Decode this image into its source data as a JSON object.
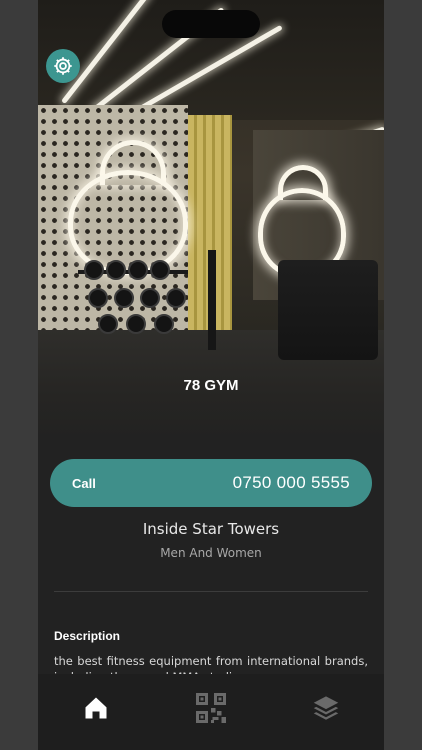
{
  "hero": {
    "title": "78 GYM"
  },
  "call": {
    "label": "Call",
    "number": "0750 000 5555"
  },
  "info": {
    "location": "Inside Star Towers",
    "audience": "Men And Women"
  },
  "description": {
    "heading": "Description",
    "text": "the best fitness equipment from international brands, including the ... and MMA studio ..."
  },
  "tabs": [
    {
      "icon": "home-icon",
      "active": true
    },
    {
      "icon": "qr-code-icon",
      "active": false
    },
    {
      "icon": "layers-icon",
      "active": false
    }
  ],
  "colors": {
    "accent": "#3f8f8a",
    "background": "#222222"
  }
}
